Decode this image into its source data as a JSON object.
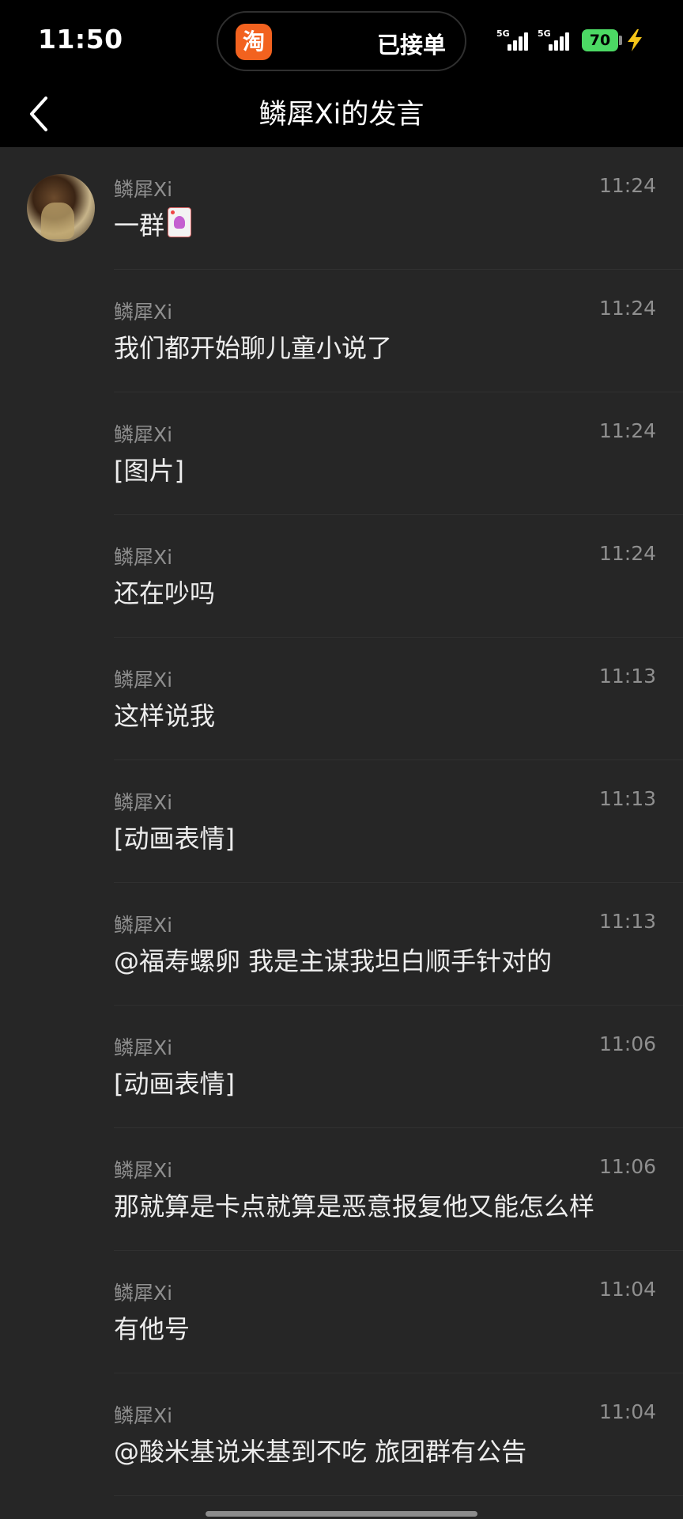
{
  "status_bar": {
    "time": "11:50",
    "island_app_glyph": "淘",
    "island_text": "已接单",
    "signal_1_label": "5G",
    "signal_2_label": "5G",
    "battery_level": "70",
    "battery_color": "#4cd964"
  },
  "nav": {
    "back_icon": "chevron-left-icon",
    "title": "鳞犀Xi的发言"
  },
  "messages": [
    {
      "sender": "鳞犀Xi",
      "time": "11:24",
      "text": "一群",
      "has_avatar": true,
      "sticker": "card-sticker"
    },
    {
      "sender": "鳞犀Xi",
      "time": "11:24",
      "text": "我们都开始聊儿童小说了"
    },
    {
      "sender": "鳞犀Xi",
      "time": "11:24",
      "text": "[图片]"
    },
    {
      "sender": "鳞犀Xi",
      "time": "11:24",
      "text": "还在吵吗"
    },
    {
      "sender": "鳞犀Xi",
      "time": "11:13",
      "text": "这样说我"
    },
    {
      "sender": "鳞犀Xi",
      "time": "11:13",
      "text": "[动画表情]"
    },
    {
      "sender": "鳞犀Xi",
      "time": "11:13",
      "text": "@福寿螺卵 我是主谋我坦白顺手针对的"
    },
    {
      "sender": "鳞犀Xi",
      "time": "11:06",
      "text": "[动画表情]"
    },
    {
      "sender": "鳞犀Xi",
      "time": "11:06",
      "text": "那就算是卡点就算是恶意报复他又能怎么样"
    },
    {
      "sender": "鳞犀Xi",
      "time": "11:04",
      "text": "有他号"
    },
    {
      "sender": "鳞犀Xi",
      "time": "11:04",
      "text": "@酸米基说米基到不吃 旅团群有公告"
    }
  ]
}
